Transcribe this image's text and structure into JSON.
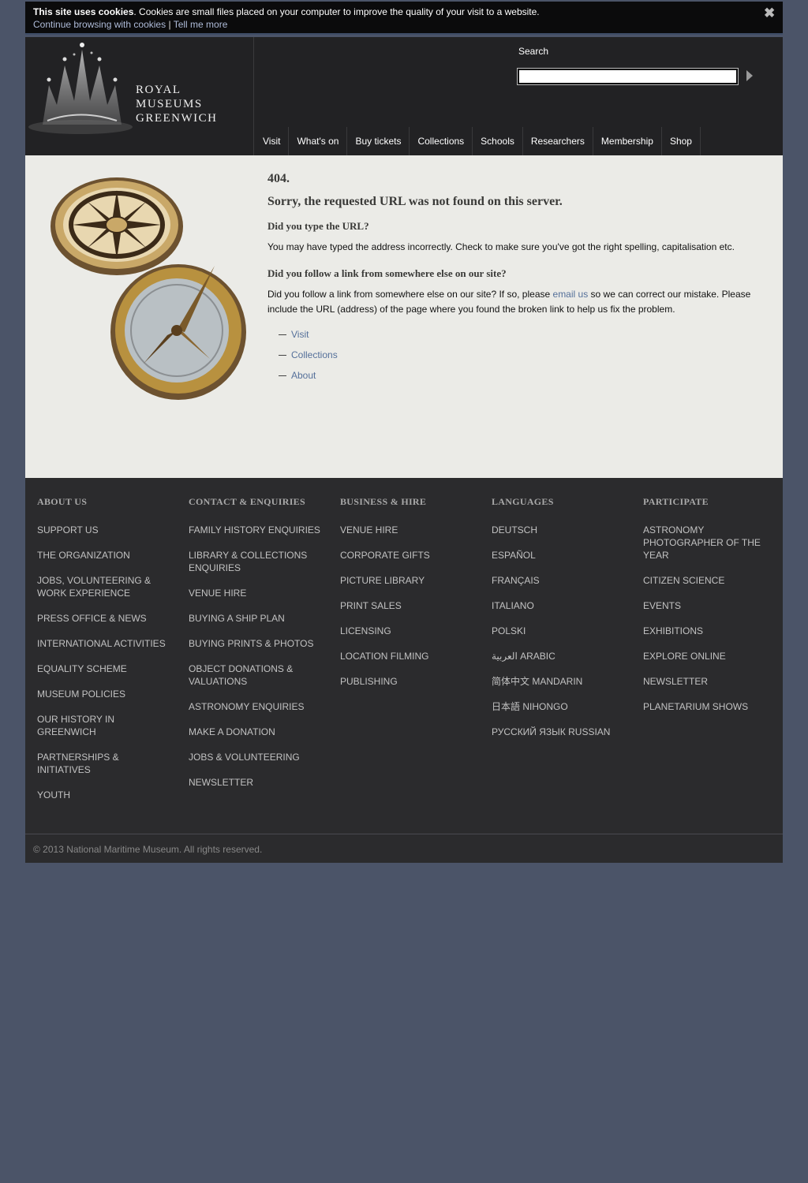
{
  "cookie": {
    "bold": "This site uses cookies",
    "text": ". Cookies are small files placed on your computer to improve the quality of your visit to a website.",
    "continue_link": "Continue browsing with cookies",
    "separator": "|",
    "tell_more_link": "Tell me more",
    "close_icon": "close-icon"
  },
  "header": {
    "logo_lines": [
      "ROYAL",
      "MUSEUMS",
      "GREENWICH"
    ],
    "search_label": "Search",
    "search_value": "",
    "nav": [
      "Visit",
      "What's on",
      "Buy tickets",
      "Collections",
      "Schools",
      "Researchers",
      "Membership",
      "Shop"
    ]
  },
  "main": {
    "code": "404.",
    "title": "Sorry, the requested URL was not found on this server.",
    "q1": "Did you type the URL?",
    "p1": "You may have typed the address incorrectly. Check to make sure you've got the right spelling, capitalisation etc.",
    "q2": "Did you follow a link from somewhere else on our site?",
    "p2_before": "Did you follow a link from somewhere else on our site? If so, please ",
    "p2_link": "email us",
    "p2_after": " so we can correct our mistake. Please include the URL (address) of the page where you found the broken link to help us fix the problem.",
    "links": [
      "Visit",
      "Collections",
      "About"
    ]
  },
  "footer": {
    "columns": [
      {
        "heading": "ABOUT US",
        "items": [
          "SUPPORT US",
          "THE ORGANIZATION",
          "JOBS, VOLUNTEERING & WORK EXPERIENCE",
          "PRESS OFFICE & NEWS",
          "INTERNATIONAL ACTIVITIES",
          "EQUALITY SCHEME",
          "MUSEUM POLICIES",
          "OUR HISTORY IN GREENWICH",
          "PARTNERSHIPS & INITIATIVES",
          "YOUTH"
        ]
      },
      {
        "heading": "CONTACT & ENQUIRIES",
        "items": [
          "FAMILY HISTORY ENQUIRIES",
          "LIBRARY & COLLECTIONS ENQUIRIES",
          "VENUE HIRE",
          "BUYING A SHIP PLAN",
          "BUYING PRINTS & PHOTOS",
          "OBJECT DONATIONS & VALUATIONS",
          "ASTRONOMY ENQUIRIES",
          "MAKE A DONATION",
          "JOBS & VOLUNTEERING",
          "NEWSLETTER"
        ]
      },
      {
        "heading": "BUSINESS & HIRE",
        "items": [
          "VENUE HIRE",
          "CORPORATE GIFTS",
          "PICTURE LIBRARY",
          "PRINT SALES",
          "LICENSING",
          "LOCATION FILMING",
          "PUBLISHING"
        ]
      },
      {
        "heading": "LANGUAGES",
        "items": [
          "DEUTSCH",
          "ESPAÑOL",
          "FRANÇAIS",
          "ITALIANO",
          "POLSKI",
          "العربية ARABIC",
          "简体中文 MANDARIN",
          "日本語 NIHONGO",
          "РУССКИЙ ЯЗЫК RUSSIAN"
        ]
      },
      {
        "heading": "PARTICIPATE",
        "items": [
          "ASTRONOMY PHOTOGRAPHER OF THE YEAR",
          "CITIZEN SCIENCE",
          "EVENTS",
          "EXHIBITIONS",
          "EXPLORE ONLINE",
          "NEWSLETTER",
          "PLANETARIUM SHOWS"
        ]
      }
    ],
    "copyright": "© 2013 National Maritime Museum. All rights reserved."
  },
  "colors": {
    "page_bg": "#4b5468",
    "header_bg": "#222224",
    "content_bg": "#ebebe7",
    "footer_bg": "#2b2b2d",
    "link": "#55709a"
  }
}
